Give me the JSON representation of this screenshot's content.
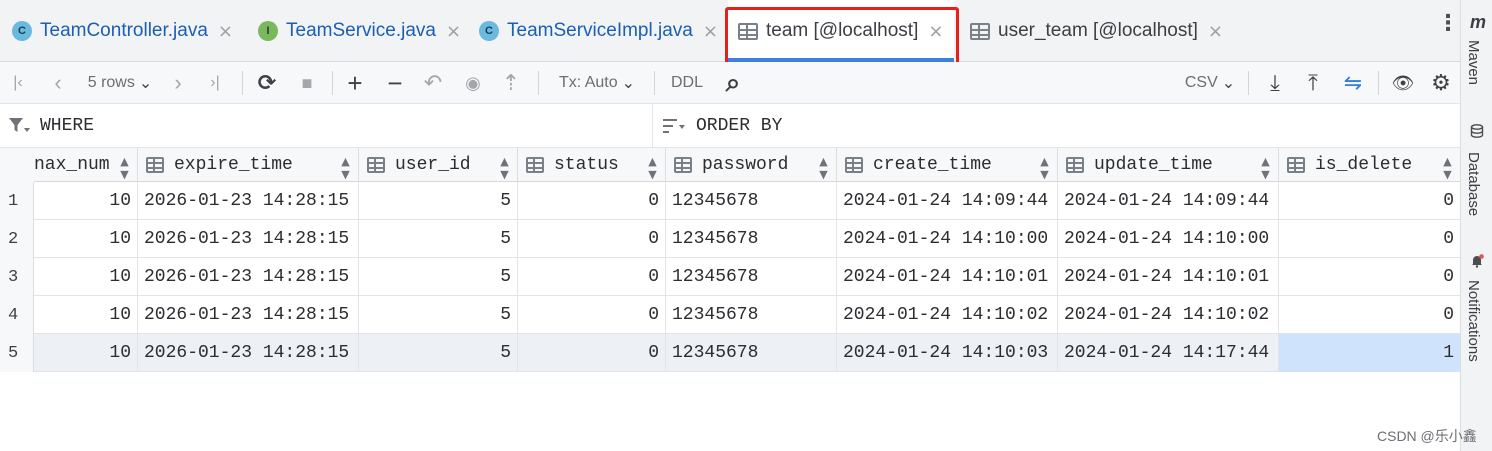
{
  "tabs": [
    {
      "label": "TeamController.java",
      "icon": "class-icon",
      "icon_letter": "C"
    },
    {
      "label": "TeamService.java",
      "icon": "interface-icon",
      "icon_letter": "I"
    },
    {
      "label": "TeamServiceImpl.java",
      "icon": "class-icon",
      "icon_letter": "C"
    },
    {
      "label": "team [@localhost]",
      "icon": "table-icon",
      "active": true
    },
    {
      "label": "user_team [@localhost]",
      "icon": "table-icon"
    }
  ],
  "tab_close_glyph": "×",
  "more_glyph": "⋮",
  "right_rail": {
    "maven_glyph": "m",
    "maven_label": "Maven",
    "database_label": "Database",
    "notifications_label": "Notifications"
  },
  "toolbar": {
    "first_glyph": "|‹",
    "prev_glyph": "‹",
    "rows_label": "5 rows",
    "rows_chevron": "⌄",
    "next_glyph": "›",
    "last_glyph": "›|",
    "refresh_glyph": "⟳",
    "stop_glyph": "■",
    "add_glyph": "+",
    "remove_glyph": "−",
    "revert_glyph": "↶",
    "preview_glyph": "◉",
    "submit_glyph": "⇡",
    "tx_label": "Tx: Auto",
    "tx_chevron": "⌄",
    "ddl_label": "DDL",
    "search_glyph": "⌕",
    "export_format": "CSV",
    "export_chevron": "⌄",
    "download_glyph": "⤓",
    "upload_glyph": "⤒",
    "compare_glyph": "⇋",
    "view_glyph": "👁",
    "settings_glyph": "⚙"
  },
  "filter": {
    "where_label": "WHERE",
    "order_by_label": "ORDER BY"
  },
  "columns": [
    "max_num",
    "expire_time",
    "user_id",
    "status",
    "password",
    "create_time",
    "update_time",
    "is_delete"
  ],
  "header_visible": {
    "first_column": "nax_num"
  },
  "rows": [
    {
      "num": "1",
      "max_num": "10",
      "expire_time": "2026-01-23 14:28:15",
      "user_id": "5",
      "status": "0",
      "password": "12345678",
      "create_time": "2024-01-24 14:09:44",
      "update_time": "2024-01-24 14:09:44",
      "is_delete": "0"
    },
    {
      "num": "2",
      "max_num": "10",
      "expire_time": "2026-01-23 14:28:15",
      "user_id": "5",
      "status": "0",
      "password": "12345678",
      "create_time": "2024-01-24 14:10:00",
      "update_time": "2024-01-24 14:10:00",
      "is_delete": "0"
    },
    {
      "num": "3",
      "max_num": "10",
      "expire_time": "2026-01-23 14:28:15",
      "user_id": "5",
      "status": "0",
      "password": "12345678",
      "create_time": "2024-01-24 14:10:01",
      "update_time": "2024-01-24 14:10:01",
      "is_delete": "0"
    },
    {
      "num": "4",
      "max_num": "10",
      "expire_time": "2026-01-23 14:28:15",
      "user_id": "5",
      "status": "0",
      "password": "12345678",
      "create_time": "2024-01-24 14:10:02",
      "update_time": "2024-01-24 14:10:02",
      "is_delete": "0"
    },
    {
      "num": "5",
      "max_num": "10",
      "expire_time": "2026-01-23 14:28:15",
      "user_id": "5",
      "status": "0",
      "password": "12345678",
      "create_time": "2024-01-24 14:10:03",
      "update_time": "2024-01-24 14:17:44",
      "is_delete": "1"
    }
  ],
  "sort_glyph": "▲▼",
  "watermark": "CSDN @乐小鑫",
  "colors": {
    "accent": "#3f7fe0",
    "highlight_box": "#e8201c",
    "selected_cell": "#cfe4fc"
  }
}
